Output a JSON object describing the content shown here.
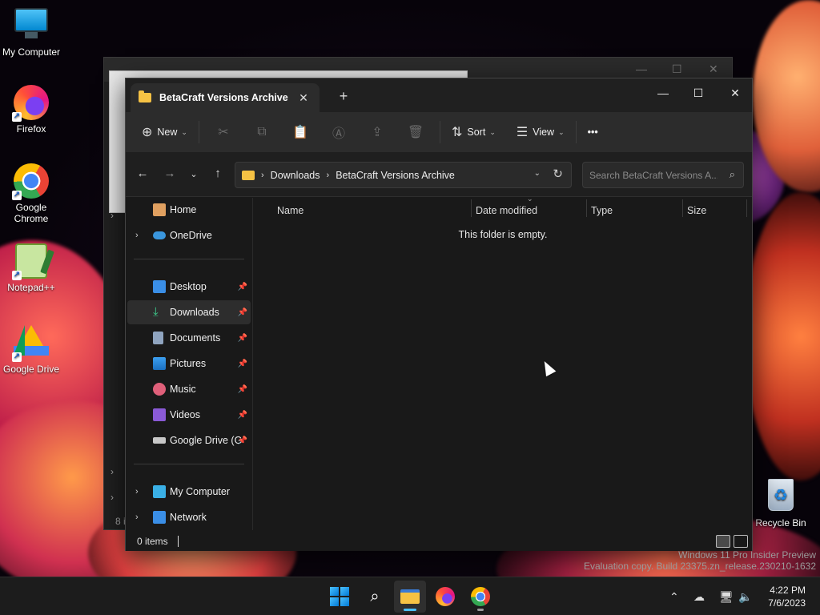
{
  "desktop": {
    "icons": [
      {
        "label": "My Computer"
      },
      {
        "label": "Firefox"
      },
      {
        "label": "Google Chrome"
      },
      {
        "label": "Notepad++"
      },
      {
        "label": "Google Drive"
      },
      {
        "label": "Recycle Bin"
      }
    ],
    "watermark": {
      "line1": "Windows 11 Pro Insider Preview",
      "line2": "Evaluation copy. Build 23375.zn_release.230210-1632"
    }
  },
  "background_window": {
    "status_count": "8 i"
  },
  "explorer": {
    "tab_title": "BetaCraft Versions Archive",
    "new_tab": "+",
    "toolbar": {
      "new_label": "New",
      "sort_label": "Sort",
      "view_label": "View",
      "more_label": "•••"
    },
    "breadcrumbs": [
      "Downloads",
      "BetaCraft Versions Archive"
    ],
    "search_placeholder": "Search BetaCraft Versions A...",
    "sidebar": {
      "items": [
        {
          "label": "Home",
          "icon": "home-icon"
        },
        {
          "label": "OneDrive",
          "icon": "onedrive-icon"
        },
        {
          "label": "Desktop",
          "icon": "desktop-icon",
          "pinned": true
        },
        {
          "label": "Downloads",
          "icon": "downloads-icon",
          "pinned": true,
          "selected": true
        },
        {
          "label": "Documents",
          "icon": "documents-icon",
          "pinned": true
        },
        {
          "label": "Pictures",
          "icon": "pictures-icon",
          "pinned": true
        },
        {
          "label": "Music",
          "icon": "music-icon",
          "pinned": true
        },
        {
          "label": "Videos",
          "icon": "videos-icon",
          "pinned": true
        },
        {
          "label": "Google Drive (G:",
          "icon": "drive-icon",
          "pinned": true
        },
        {
          "label": "My Computer",
          "icon": "computer-icon"
        },
        {
          "label": "Network",
          "icon": "network-icon"
        }
      ]
    },
    "columns": [
      "Name",
      "Date modified",
      "Type",
      "Size"
    ],
    "empty_message": "This folder is empty.",
    "status": "0 items"
  },
  "taskbar": {
    "time": "4:22 PM",
    "date": "7/6/2023",
    "apps": [
      "start",
      "search",
      "file-explorer",
      "firefox",
      "chrome"
    ]
  },
  "colors": {
    "accent": "#4cc2ff",
    "folder": "#f6c244",
    "window_bg": "#191919",
    "toolbar_bg": "#2c2c2c"
  }
}
